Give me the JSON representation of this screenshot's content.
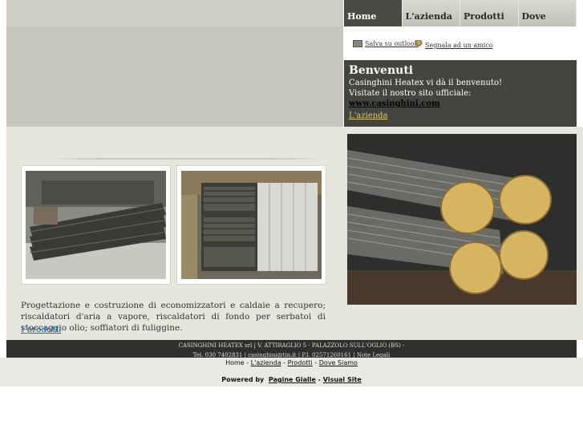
{
  "nav": {
    "items": [
      "Home",
      "L'azienda",
      "Prodotti",
      "Dove Siamo"
    ],
    "active": 0
  },
  "tools": {
    "outlook": "Salva su outlook",
    "friend": "Segnala ad un amico"
  },
  "welcome": {
    "title": "Benvenuti",
    "line1": "Casinghini Heatex vi dà il benvenuto!",
    "line2": "Visitate il nostro sito ufficiale:",
    "site_link": "www.casinghini.com",
    "azienda_link": "L'azienda"
  },
  "content": {
    "description": "Progettazione e costruzione di economizzatori e caldaie a recupero; riscaldatori d'aria a vapore, riscaldatori di fondo per serbatoi di stoccaggio olio; soffiatori di fuliggine.",
    "products_link": "I prodotti"
  },
  "footer": {
    "line1": "CASINGHINI HEATEX srl | V. ATTIRAGLIO 5 - PALAZZOLO SULL'OGLIO (BS) -",
    "line2": "Tel. 030 7402831 | casinghini@tin.it | P.I. 02571260161 | Note Legali",
    "nav": {
      "home": "Home",
      "sep": " - ",
      "azienda": "L'azienda",
      "prodotti": "Prodotti",
      "dove": "Dove Siamo"
    },
    "powered_prefix": "Powered by",
    "pagine_gialle": "Pagine Gialle",
    "visual_site": "Visual Site"
  }
}
